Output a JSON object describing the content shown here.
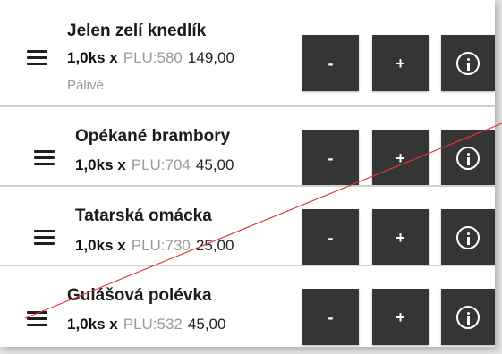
{
  "items": [
    {
      "name": "Jelen zelí knedlík",
      "qty": "1,0ks x",
      "plu": "PLU:580",
      "price": "149,00",
      "note": "Pálivé",
      "minus_label": "-",
      "plus_label": "+"
    },
    {
      "name": "Opékané brambory",
      "qty": "1,0ks x",
      "plu": "PLU:704",
      "price": "45,00",
      "minus_label": "-",
      "plus_label": "+"
    },
    {
      "name": "Tatarská omácka",
      "qty": "1,0ks x",
      "plu": "PLU:730",
      "price": "25,00",
      "minus_label": "-",
      "plus_label": "+"
    },
    {
      "name": "Gulášová polévka",
      "qty": "1,0ks x",
      "plu": "PLU:532",
      "price": "45,00",
      "minus_label": "-",
      "plus_label": "+"
    }
  ],
  "icons": {
    "reorder": "drag-handle-icon",
    "info": "info-icon"
  },
  "colors": {
    "button_bg": "#353535",
    "annotation_line": "#e0393e",
    "muted_text": "#9a9a9a"
  }
}
